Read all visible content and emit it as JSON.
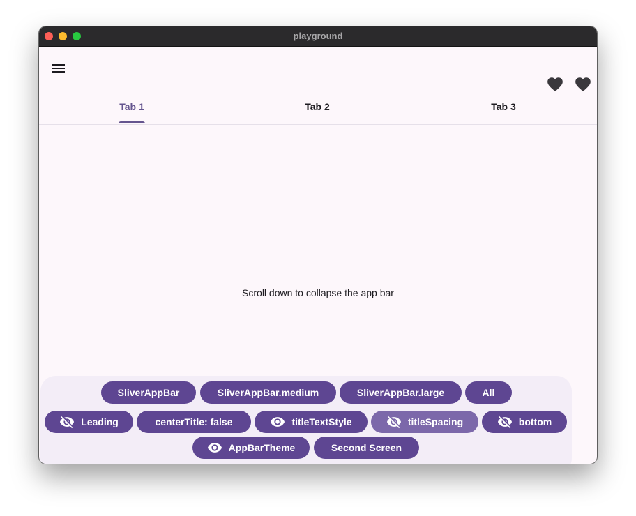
{
  "window": {
    "title": "playground"
  },
  "tabs": [
    {
      "label": "Tab 1"
    },
    {
      "label": "Tab 2"
    },
    {
      "label": "Tab 3"
    }
  ],
  "body": {
    "message": "Scroll down to collapse the app bar"
  },
  "controls": {
    "row1": [
      {
        "label": "SliverAppBar"
      },
      {
        "label": "SliverAppBar.medium"
      },
      {
        "label": "SliverAppBar.large"
      },
      {
        "label": "All"
      }
    ],
    "row2": [
      {
        "label": "Leading",
        "icon": "visibility-off-icon"
      },
      {
        "label": "centerTitle: false"
      },
      {
        "label": "titleTextStyle",
        "icon": "visibility-icon"
      },
      {
        "label": "titleSpacing",
        "icon": "visibility-off-icon"
      },
      {
        "label": "bottom",
        "icon": "visibility-off-icon"
      }
    ],
    "row3": [
      {
        "label": "AppBarTheme",
        "icon": "visibility-icon"
      },
      {
        "label": "Second Screen"
      }
    ]
  },
  "colors": {
    "primary": "#65558f",
    "button": "#5e4692",
    "surface": "#fdf7fb",
    "panel": "#f3edf7"
  }
}
